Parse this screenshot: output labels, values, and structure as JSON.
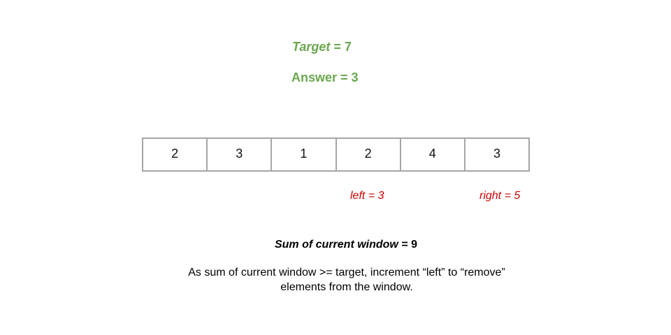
{
  "header": {
    "target_label": "Target",
    "target_eq": " = 7",
    "answer_text": "Answer = 3"
  },
  "array": {
    "values": [
      "2",
      "3",
      "1",
      "2",
      "4",
      "3"
    ]
  },
  "pointers": {
    "left": "left = 3",
    "right": "right = 5"
  },
  "sum": {
    "label": "Sum of current window",
    "value": " = 9"
  },
  "explanation": {
    "line1": "As sum of current window >= target, increment “left” to “remove”",
    "line2": "elements from the window."
  },
  "colors": {
    "accent_green": "#6aa84f",
    "pointer_red": "#cc0000",
    "cell_border": "#a6a6a6"
  }
}
